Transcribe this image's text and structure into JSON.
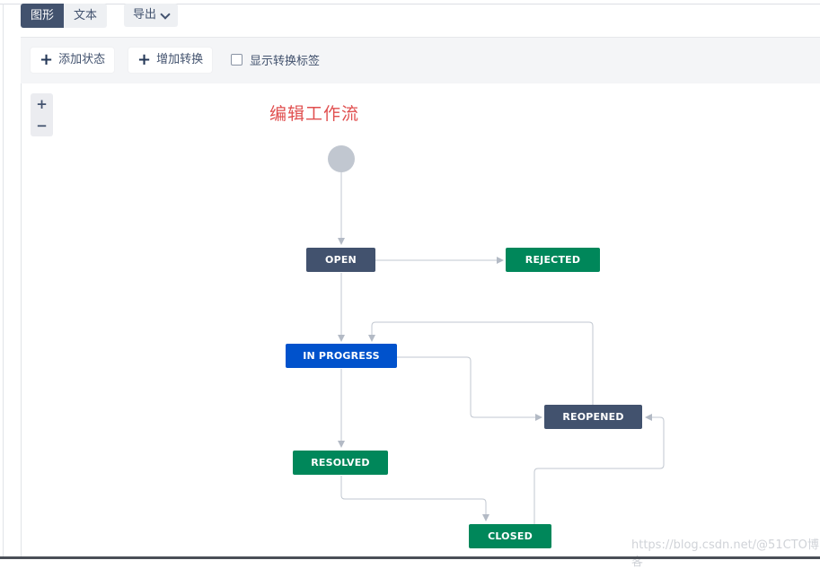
{
  "view_toggle": {
    "diagram_label": "图形",
    "text_label": "文本"
  },
  "export": {
    "label": "导出"
  },
  "toolbar": {
    "add_status_label": "添加状态",
    "add_transition_label": "增加转换",
    "show_labels_label": "显示转换标签",
    "show_labels_checked": false
  },
  "zoom": {
    "in_label": "+",
    "out_label": "−"
  },
  "annotation": "编辑工作流",
  "statuses": {
    "open": "OPEN",
    "rejected": "REJECTED",
    "in_progress": "IN PROGRESS",
    "reopened": "REOPENED",
    "resolved": "RESOLVED",
    "closed": "CLOSED"
  },
  "status_colors": {
    "todo": "#42526e",
    "done": "#00875a",
    "in_progress": "#0052cc"
  },
  "watermark": "https://blog.csdn.net/@51CTO博客"
}
